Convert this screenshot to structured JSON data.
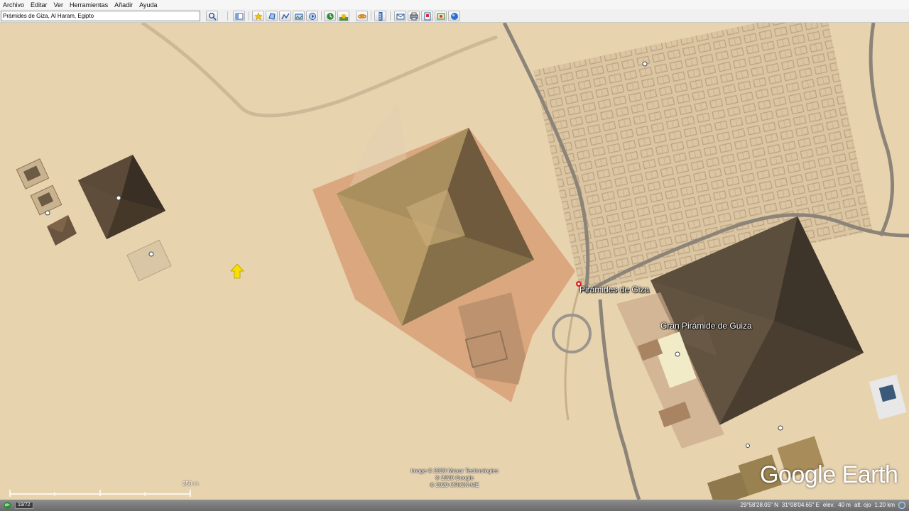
{
  "menu": {
    "items": [
      "Archivo",
      "Editar",
      "Ver",
      "Herramientas",
      "Añadir",
      "Ayuda"
    ]
  },
  "search": {
    "value": "Prámides de Giza, Al Haram, Egipto"
  },
  "toolbar": {
    "icons": [
      "search-icon",
      "sidebar-icon",
      "placemark-icon",
      "polygon-icon",
      "path-icon",
      "image-overlay-icon",
      "tour-icon",
      "history-icon",
      "sunlight-icon",
      "planets-icon",
      "ruler-icon",
      "email-icon",
      "print-icon",
      "save-image-icon",
      "maps-icon",
      "earth-icon"
    ]
  },
  "map": {
    "labels": {
      "piramides": "Pirámides de Giza",
      "gran": "Gran Pirámide de Guiza"
    },
    "credits": [
      "Image © 2020 Maxar Technologies",
      "© 2020 Google",
      "© 2020 ORION-ME"
    ],
    "brand": "Google Earth",
    "scale": "258 m"
  },
  "status": {
    "date": "19/72",
    "lat": "29°58'28.05\" N",
    "lon": "31°08'04.65\" E",
    "elev_label": "elev.",
    "elev_value": "40 m",
    "eye_label": "alt. ojo",
    "eye_value": "1.20 km"
  },
  "colors": {
    "sand": "#e8d3b0",
    "pyramid_dark": "#5a4632",
    "pyramid_light": "#b89c6c",
    "label_text": "#ffffff",
    "arrow": "#f7e000"
  }
}
